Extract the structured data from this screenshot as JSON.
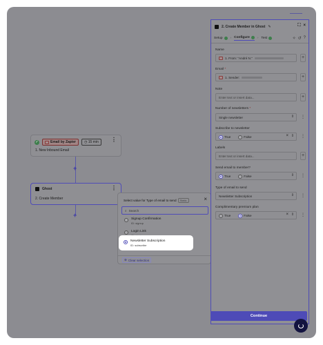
{
  "canvas": {
    "step1": {
      "app_label": "Email by Zapier",
      "timer": "15 min",
      "title": "1. New Inbound Email"
    },
    "step2": {
      "app_label": "Ghost",
      "title": "2. Create Member"
    }
  },
  "popup": {
    "title": "Select value for Type of email to send",
    "badge": "Static",
    "search_placeholder": "Search",
    "options": [
      {
        "label": "Signup Confirmation",
        "id": "ID: signup",
        "selected": false
      },
      {
        "label": "Login Link",
        "id": "ID: signin",
        "selected": false
      },
      {
        "label": "Newsletter Subscription",
        "id": "ID: subscribe",
        "selected": true
      }
    ],
    "clear_label": "Clear selection"
  },
  "panel": {
    "title": "2. Create Member in Ghost",
    "tabs": [
      {
        "label": "Setup"
      },
      {
        "label": "Configure"
      },
      {
        "label": "Test"
      }
    ],
    "fields": {
      "name": {
        "label": "Name",
        "value": "1. From: \"André N.\""
      },
      "email": {
        "label": "Email",
        "required_mark": "*",
        "value": "1. Sender:"
      },
      "note": {
        "label": "Note",
        "placeholder": "Enter text or insert data..."
      },
      "num_newsletters": {
        "label": "Number of newsletters",
        "required_mark": "*",
        "value": "Single newsletter"
      },
      "subscribe": {
        "label": "Subscribe to newsletter",
        "true_label": "True",
        "false_label": "False",
        "selected": "True"
      },
      "labels": {
        "label": "Labels",
        "placeholder": "Enter text or insert data..."
      },
      "send_email": {
        "label": "Send email to member?",
        "true_label": "True",
        "false_label": "False",
        "selected": "True"
      },
      "email_type": {
        "label": "Type of email to send",
        "value": "Newsletter Subscription"
      },
      "premium": {
        "label": "Complimentary premium plan",
        "true_label": "True",
        "false_label": "False",
        "selected": "False"
      }
    },
    "continue_label": "Continue"
  },
  "colors": {
    "accent": "#4e4bb7",
    "overlay": "#8c8c91",
    "success": "#3e7e4c"
  }
}
